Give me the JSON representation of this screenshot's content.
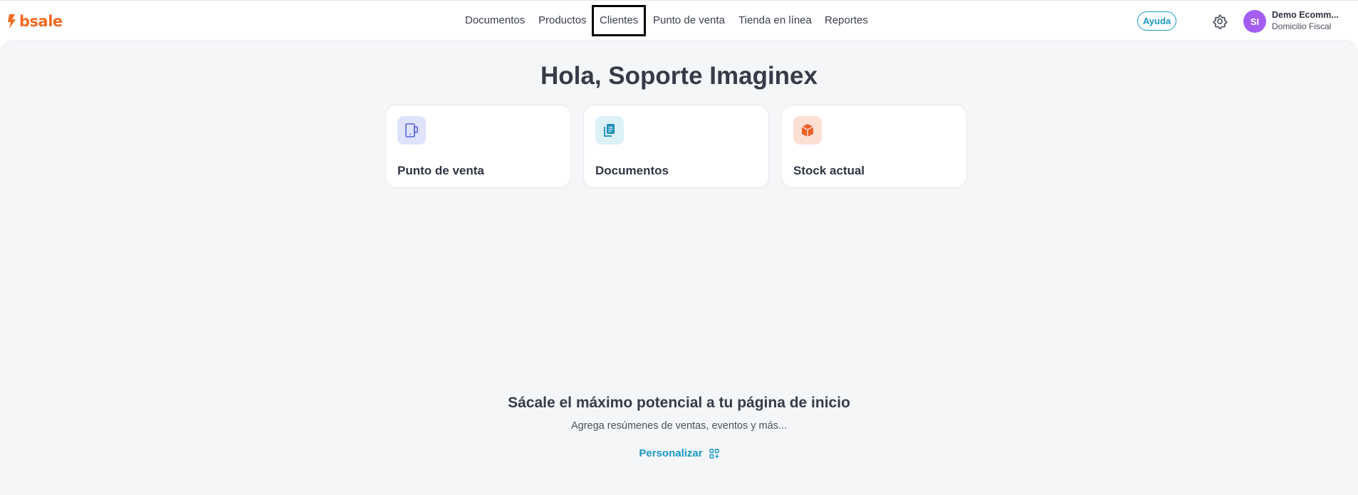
{
  "header": {
    "logo_text": "bsale",
    "nav": [
      {
        "label": "Documentos"
      },
      {
        "label": "Productos"
      },
      {
        "label": "Clientes",
        "selected": true
      },
      {
        "label": "Punto de venta"
      },
      {
        "label": "Tienda en línea"
      },
      {
        "label": "Reportes"
      }
    ],
    "help_label": "Ayuda",
    "avatar_initials": "SI",
    "account_name": "Demo Ecomm...",
    "account_subtitle": "Domicilio Fiscal"
  },
  "main": {
    "greeting": "Hola, Soporte Imaginex",
    "cards": [
      {
        "label": "Punto de venta",
        "icon": "tablet-icon"
      },
      {
        "label": "Documentos",
        "icon": "document-icon"
      },
      {
        "label": "Stock actual",
        "icon": "box-icon"
      }
    ],
    "promo_title": "Sácale el máximo potencial a tu página de inicio",
    "promo_subtitle": "Agrega resúmenes de ventas, eventos y más...",
    "personalize_label": "Personalizar"
  },
  "colors": {
    "brand": "#f26a21",
    "accent": "#1a98c4",
    "avatar": "#a35df0",
    "background": "#f5f6f8"
  }
}
